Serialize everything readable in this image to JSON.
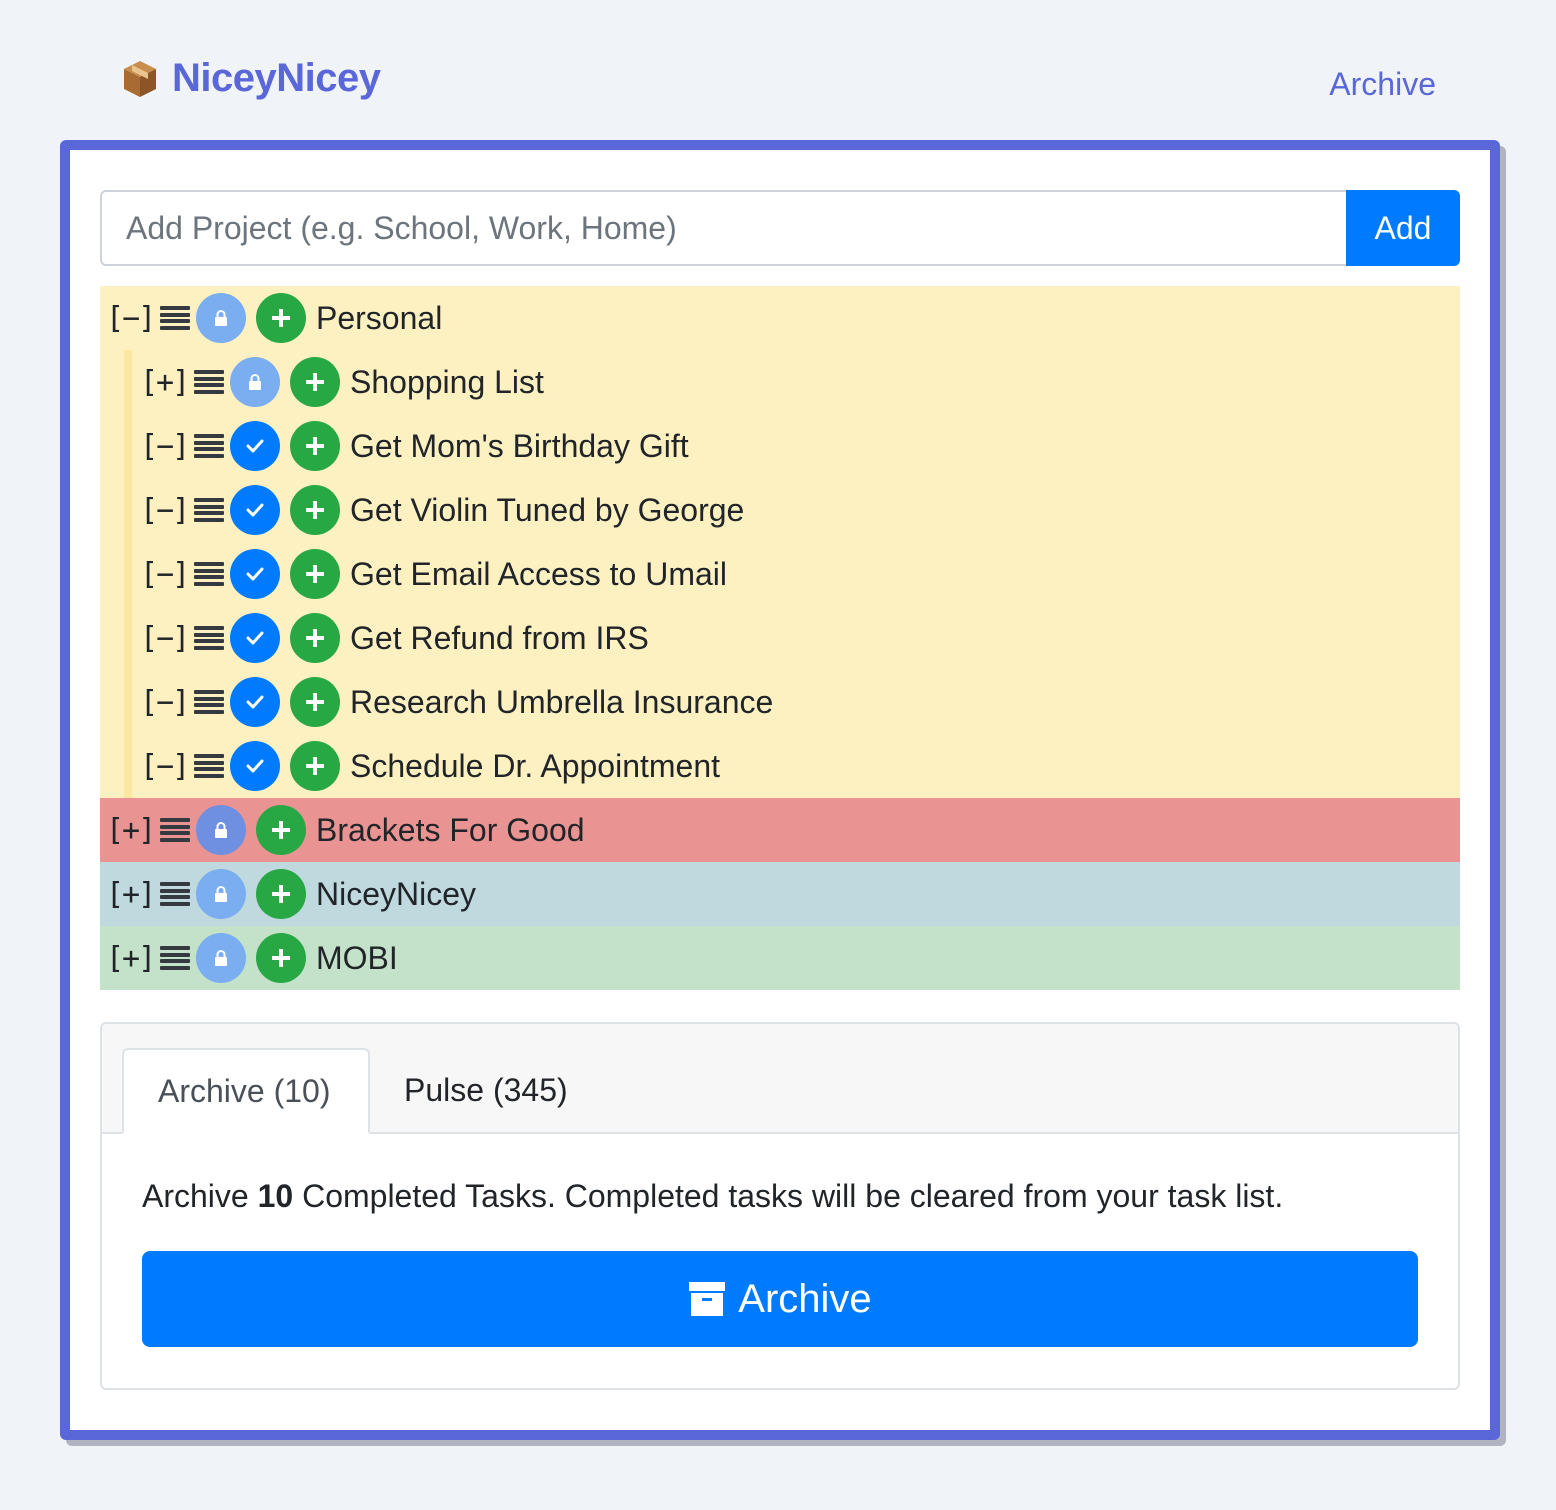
{
  "header": {
    "brand": "NiceyNicey",
    "nav_archive": "Archive"
  },
  "add_project": {
    "placeholder": "Add Project (e.g. School, Work, Home)",
    "button": "Add"
  },
  "projects": [
    {
      "toggle": "[−]",
      "title": "Personal",
      "color": "#fdf1c2",
      "children": [
        {
          "toggle": "[+]",
          "title": "Shopping List",
          "status": "lock"
        },
        {
          "toggle": "[−]",
          "title": "Get Mom's Birthday Gift",
          "status": "check"
        },
        {
          "toggle": "[−]",
          "title": "Get Violin Tuned by George",
          "status": "check"
        },
        {
          "toggle": "[−]",
          "title": "Get Email Access to Umail",
          "status": "check"
        },
        {
          "toggle": "[−]",
          "title": "Get Refund from IRS",
          "status": "check"
        },
        {
          "toggle": "[−]",
          "title": "Research Umbrella Insurance",
          "status": "check"
        },
        {
          "toggle": "[−]",
          "title": "Schedule Dr. Appointment",
          "status": "check"
        }
      ]
    },
    {
      "toggle": "[+]",
      "title": "Brackets For Good",
      "color": "#e99492"
    },
    {
      "toggle": "[+]",
      "title": "NiceyNicey",
      "color": "#bfd9de"
    },
    {
      "toggle": "[+]",
      "title": "MOBI",
      "color": "#c4e2c9"
    }
  ],
  "panel": {
    "tabs": [
      "Archive (10)",
      "Pulse (345)"
    ],
    "text_pre": "Archive ",
    "count": "10",
    "text_post": " Completed Tasks. Completed tasks will be cleared from your task list.",
    "button": "Archive"
  },
  "colors": {
    "brand": "#5a67d8",
    "primary": "#007bff",
    "success": "#28a745"
  },
  "icons": [
    "box-icon",
    "drag-handle-icon",
    "lock-icon",
    "check-icon",
    "plus-icon",
    "archive-box-icon"
  ]
}
